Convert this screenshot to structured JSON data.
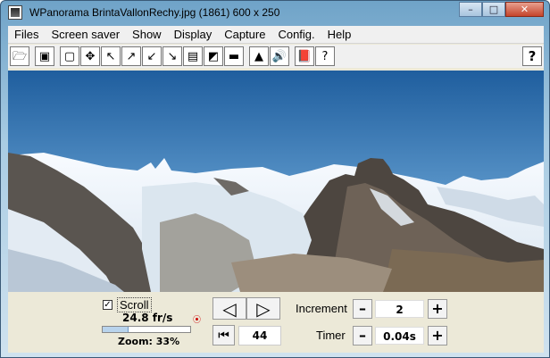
{
  "window": {
    "title": "WPanorama  BrintaVallonRechy.jpg   (1861) 600 x 250",
    "minimize": "–",
    "maximize": "□",
    "close": "✕"
  },
  "menu": [
    "Files",
    "Screen saver",
    "Show",
    "Display",
    "Capture",
    "Config.",
    "Help"
  ],
  "toolbar": {
    "buttons": [
      "open-icon",
      "picture-icon",
      "frame-icon",
      "move-icon",
      "arrow-nw-icon",
      "arrow-ne-icon",
      "arrow-sw-icon",
      "arrow-se-icon",
      "landscape-icon",
      "image-icon",
      "bar-icon",
      "palette-icon",
      "sound-icon",
      "book-icon",
      "help-icon"
    ],
    "help_label": "?"
  },
  "controls": {
    "scroll_label": "Scroll",
    "scroll_checked": true,
    "rate": "24.8 fr/s",
    "zoom": "Zoom: 33%",
    "zoom_fraction": 0.3,
    "counter": "44",
    "increment_label": "Increment",
    "increment_value": "2",
    "timer_label": "Timer",
    "timer_value": "0.04s",
    "minus": "–",
    "plus": "+"
  },
  "colors": {
    "accent": "#4f8bc6"
  }
}
